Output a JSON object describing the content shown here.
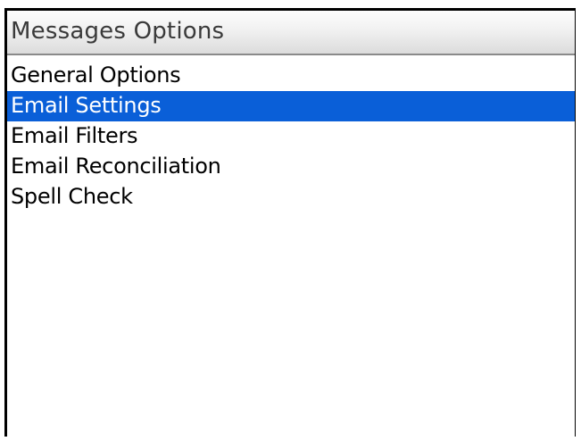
{
  "header": {
    "title": "Messages Options"
  },
  "menu": {
    "items": [
      {
        "label": "General Options",
        "selected": false
      },
      {
        "label": "Email Settings",
        "selected": true
      },
      {
        "label": "Email Filters",
        "selected": false
      },
      {
        "label": "Email Reconciliation",
        "selected": false
      },
      {
        "label": "Spell Check",
        "selected": false
      }
    ]
  },
  "colors": {
    "selection": "#0a5fd8",
    "selected_text": "#ffffff",
    "text": "#000000",
    "title_text": "#3a3a3a"
  }
}
